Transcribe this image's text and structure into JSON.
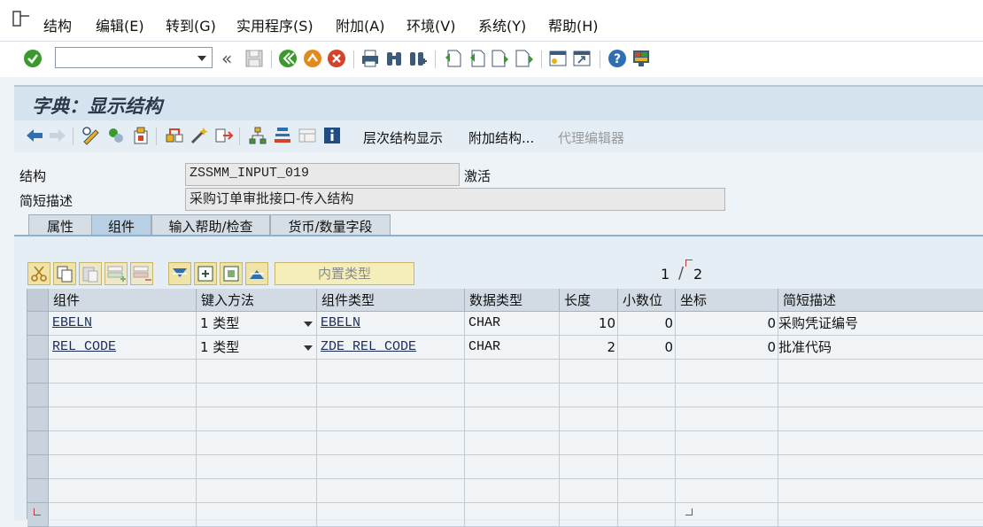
{
  "menu": {
    "items": [
      "结构",
      "编辑(E)",
      "转到(G)",
      "实用程序(S)",
      "附加(A)",
      "环境(V)",
      "系统(Y)",
      "帮助(H)"
    ]
  },
  "toolbar": {
    "command_value": "",
    "prev_label": "«",
    "icons": [
      "check-icon",
      "save-icon",
      "back-icon",
      "exit-icon",
      "cancel-icon",
      "print-icon",
      "find-icon",
      "find-next-icon",
      "first-page-icon",
      "prev-page-icon",
      "next-page-icon",
      "last-page-icon",
      "new-session-icon",
      "shortcut-icon",
      "help-icon",
      "customize-icon"
    ]
  },
  "title": "字典：显示结构",
  "app_toolbar": {
    "hierarchy_label": "层次结构显示",
    "append_label": "附加结构...",
    "proxy_label": "代理编辑器"
  },
  "form": {
    "structure_label": "结构",
    "structure_value": "ZSSMM_INPUT_019",
    "status": "激活",
    "desc_label": "简短描述",
    "desc_value": "采购订单审批接口-传入结构"
  },
  "tabs": [
    "属性",
    "组件",
    "输入帮助/检查",
    "货币/数量字段"
  ],
  "table_toolbar": {
    "builtin_label": "内置类型",
    "page_current": "1",
    "page_sep": "/",
    "page_total": "2"
  },
  "grid": {
    "columns": [
      "组件",
      "键入方法",
      "组件类型",
      "数据类型",
      "长度",
      "小数位",
      "坐标",
      "简短描述"
    ],
    "rows": [
      {
        "component": "EBELN",
        "typing": "1 类型",
        "comp_type": "EBELN",
        "data_type": "CHAR",
        "length": "10",
        "decimals": "0",
        "coord": "0",
        "desc": "采购凭证编号"
      },
      {
        "component": "REL_CODE",
        "typing": "1 类型",
        "comp_type": "ZDE_REL_CODE",
        "data_type": "CHAR",
        "length": "2",
        "decimals": "0",
        "coord": "0",
        "desc": "批准代码"
      }
    ]
  },
  "colors": {
    "accent_green": "#3b9a2e",
    "title_bg": "#d6e4ef",
    "tab_active": "#b9cfe3"
  }
}
